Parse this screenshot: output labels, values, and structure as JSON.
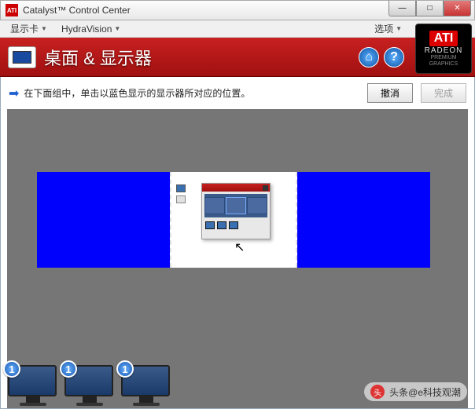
{
  "window": {
    "title": "Catalyst™ Control Center",
    "app_icon_label": "ATI"
  },
  "menubar": {
    "display_card": "显示卡",
    "hydravision": "HydraVision",
    "options": "选项"
  },
  "ati_badge": {
    "brand": "ATI",
    "line1": "RADEON",
    "line2": "PREMIUM",
    "line3": "GRAPHICS"
  },
  "header": {
    "page_title": "桌面 & 显示器"
  },
  "instruction": "在下面组中，单击以蓝色显示的显示器所对应的位置。",
  "buttons": {
    "cancel": "撤消",
    "finish": "完成"
  },
  "monitors": [
    {
      "number": "1"
    },
    {
      "number": "1"
    },
    {
      "number": "1"
    }
  ],
  "watermark": {
    "text": "头条@e科技观潮"
  }
}
